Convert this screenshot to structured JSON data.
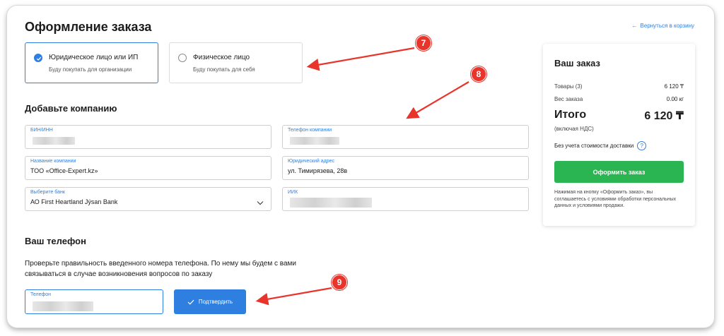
{
  "header": {
    "title": "Оформление заказа",
    "back_arrow": "←",
    "back_label": "Вернуться в корзину"
  },
  "customer_type": {
    "options": [
      {
        "title": "Юридическое лицо или ИП",
        "subtitle": "Буду покупать для организации",
        "selected": true
      },
      {
        "title": "Физическое лицо",
        "subtitle": "Буду покупать для себя",
        "selected": false
      }
    ]
  },
  "company": {
    "title": "Добавьте компанию",
    "fields": {
      "bin": {
        "label": "БИН/ИНН",
        "value": ""
      },
      "phone": {
        "label": "Телефон компании",
        "value": ""
      },
      "name": {
        "label": "Название компании",
        "value": "ТОО «Office-Expert.kz»"
      },
      "address": {
        "label": "Юридический адрес",
        "value": "ул. Тимирязева, 28в"
      },
      "bank": {
        "label": "Выберите банк",
        "value": "АО First Heartland Jýsan Bank"
      },
      "iik": {
        "label": "ИИК",
        "value": ""
      }
    }
  },
  "phone_section": {
    "title": "Ваш телефон",
    "description": "Проверьте правильность введенного номера телефона. По нему мы будем с вами связываться в случае возникновения вопросов по заказу",
    "phone_label": "Телефон",
    "phone_value": "",
    "confirm_label": "Подтвердить"
  },
  "order": {
    "title": "Ваш заказ",
    "goods_label": "Товары (3)",
    "goods_value": "6 120 ₸",
    "weight_label": "Вес заказа",
    "weight_value": "0.00 кг",
    "total_label": "Итого",
    "total_value": "6 120 ₸",
    "vat_note": "(включая НДС)",
    "delivery_note": "Без учета стоимости доставки",
    "help_glyph": "?",
    "submit_label": "Оформить заказ",
    "legal_note": "Нажимая на кнопку «Оформить заказ», вы соглашаетесь с условиями обработки персональных данных и условиями продажи."
  },
  "annotations": {
    "badges": [
      "7",
      "8",
      "9"
    ],
    "color": "#e8342b"
  },
  "colors": {
    "accent": "#2f7fe0",
    "submit": "#2ab552"
  }
}
